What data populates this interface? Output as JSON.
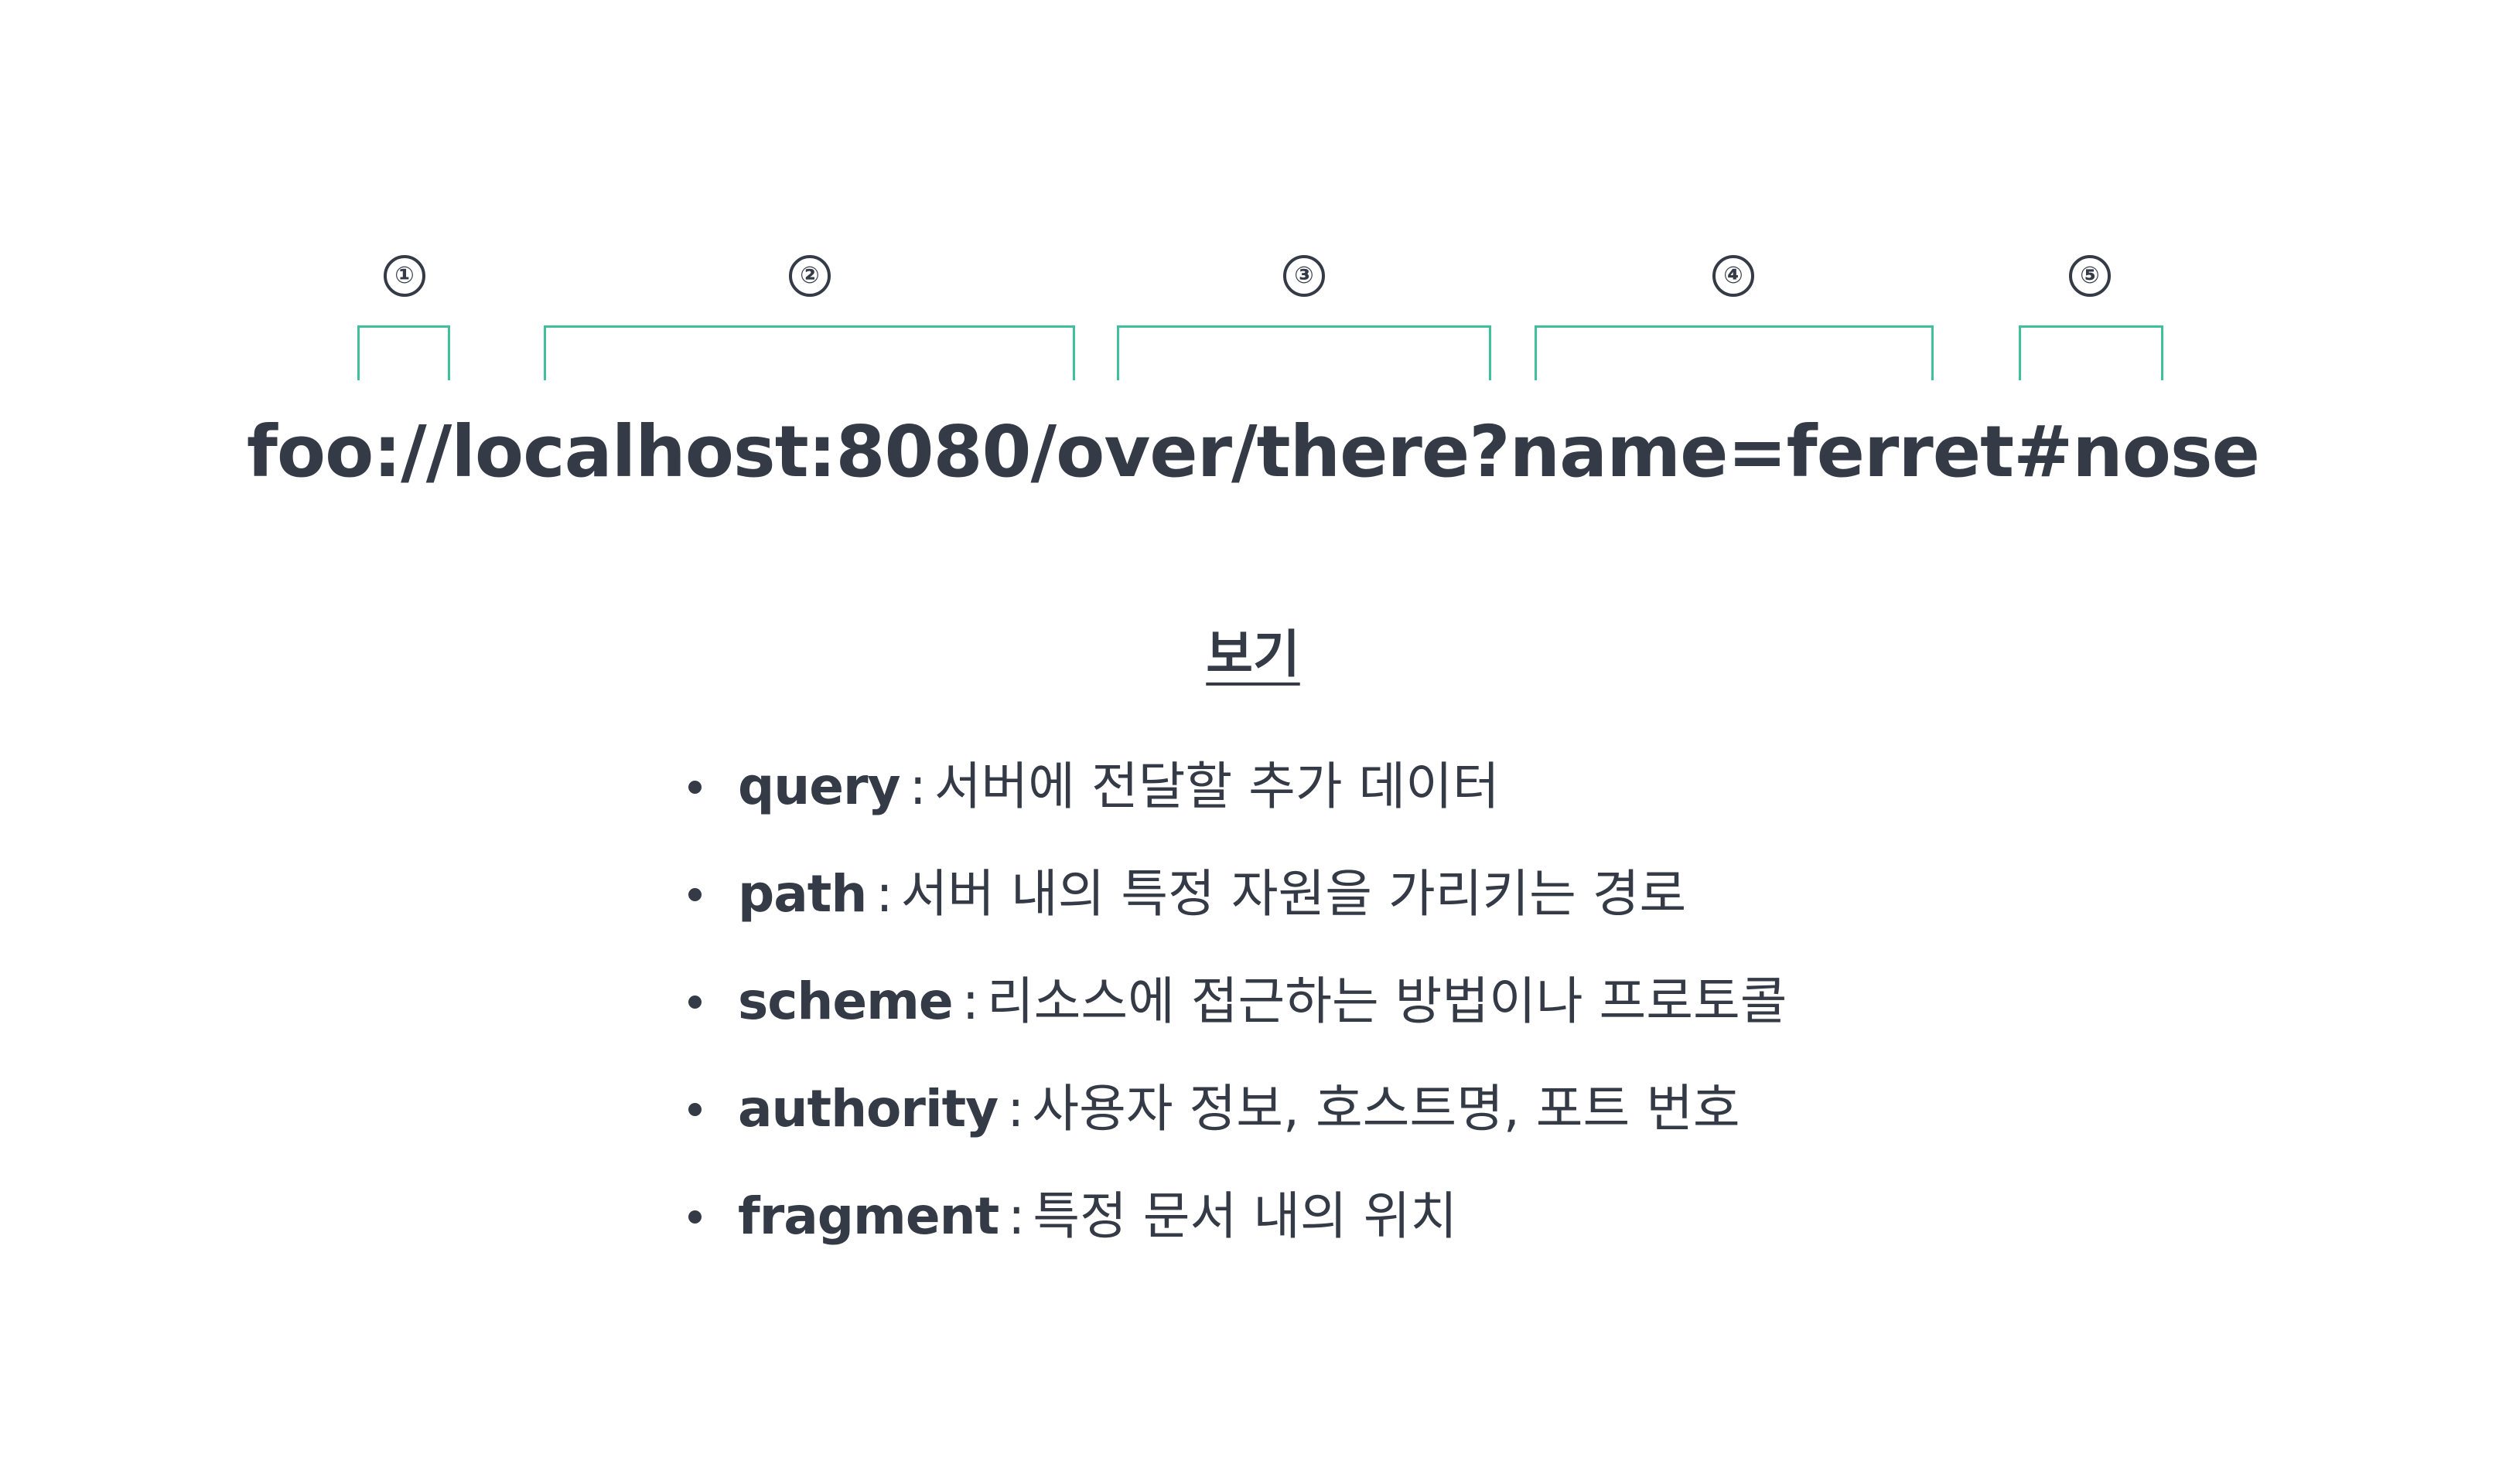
{
  "markers": [
    "①",
    "②",
    "③",
    "④",
    "⑤"
  ],
  "url": "foo://localhost:8080/over/there?name=ferret#nose",
  "legend": {
    "title": "보기",
    "items": [
      {
        "term": "query",
        "separator": ":",
        "description": "서버에 전달할 추가 데이터"
      },
      {
        "term": "path",
        "separator": ":",
        "description": "서버 내의 특정 자원을 가리키는 경로"
      },
      {
        "term": "scheme",
        "separator": ":",
        "description": "리소스에 접근하는 방법이나 프로토콜"
      },
      {
        "term": "authority",
        "separator": ":",
        "description": "사용자 정보, 호스트명, 포트 번호"
      },
      {
        "term": "fragment",
        "separator": ":",
        "description": "특정 문서 내의 위치"
      }
    ]
  },
  "colors": {
    "text": "#343a46",
    "bracket": "#3fbf9b",
    "background": "#ffffff"
  }
}
